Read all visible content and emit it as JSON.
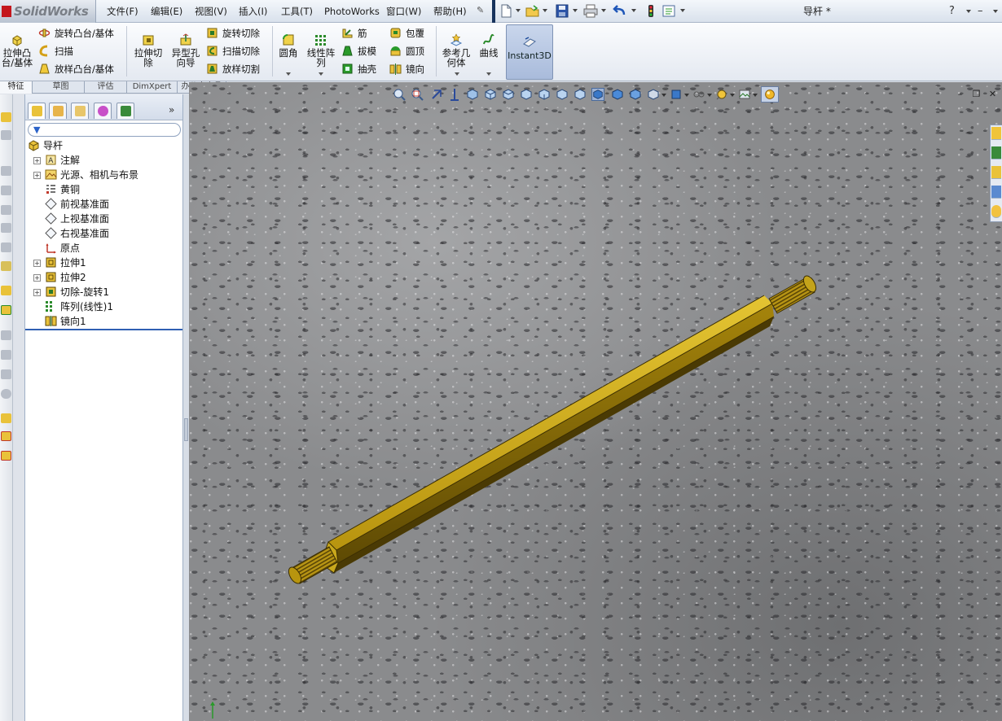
{
  "app": {
    "name": "SolidWorks",
    "brand_color": "#c4161c"
  },
  "menu": [
    "文件(F)",
    "编辑(E)",
    "视图(V)",
    "插入(I)",
    "工具(T)",
    "PhotoWorks",
    "窗口(W)",
    "帮助(H)"
  ],
  "document": {
    "title": "导杆 *"
  },
  "help": {
    "label": "?"
  },
  "commands": {
    "extrude_boss": "拉伸凸台/基体",
    "revolve_boss": "旋转凸台/基体",
    "sweep": "扫描",
    "loft_boss": "放样凸台/基体",
    "extrude_cut": "拉伸切除",
    "hole_wizard": "异型孔向导",
    "revolve_cut": "旋转切除",
    "sweep_cut": "扫描切除",
    "loft_cut": "放样切割",
    "fillet": "圆角",
    "linear_pattern": "线性阵列",
    "rib": "筋",
    "draft": "拔模",
    "shell": "抽壳",
    "wrap": "包覆",
    "dome": "圆顶",
    "mirror": "镜向",
    "ref_geometry": "参考几何体",
    "curves": "曲线",
    "instant3d": "Instant3D"
  },
  "tabs": [
    "特征",
    "草图",
    "评估",
    "DimXpert",
    "办公室产品"
  ],
  "feature_tree": {
    "root": "导杆",
    "items": [
      {
        "label": "注解",
        "expandable": true,
        "icon": "annotation-icon"
      },
      {
        "label": "光源、相机与布景",
        "expandable": true,
        "icon": "lights-cameras-scene-icon"
      },
      {
        "label": "黄铜",
        "expandable": false,
        "icon": "material-icon"
      },
      {
        "label": "前视基准面",
        "expandable": false,
        "icon": "plane-icon"
      },
      {
        "label": "上视基准面",
        "expandable": false,
        "icon": "plane-icon"
      },
      {
        "label": "右视基准面",
        "expandable": false,
        "icon": "plane-icon"
      },
      {
        "label": "原点",
        "expandable": false,
        "icon": "origin-icon"
      },
      {
        "label": "拉伸1",
        "expandable": true,
        "icon": "extrude-feature-icon"
      },
      {
        "label": "拉伸2",
        "expandable": true,
        "icon": "extrude-feature-icon"
      },
      {
        "label": "切除-旋转1",
        "expandable": true,
        "icon": "revolve-cut-feature-icon"
      },
      {
        "label": "阵列(线性)1",
        "expandable": false,
        "icon": "linear-pattern-feature-icon"
      },
      {
        "label": "镜向1",
        "expandable": false,
        "icon": "mirror-feature-icon"
      }
    ]
  },
  "filter": {
    "placeholder": ""
  },
  "colors": {
    "brass_light": "#d2b21a",
    "brass_mid": "#b08e10",
    "brass_dark": "#5e4a04",
    "instant3d_active": "#b4c4e0",
    "rollback_bar": "#2f5fb3"
  }
}
